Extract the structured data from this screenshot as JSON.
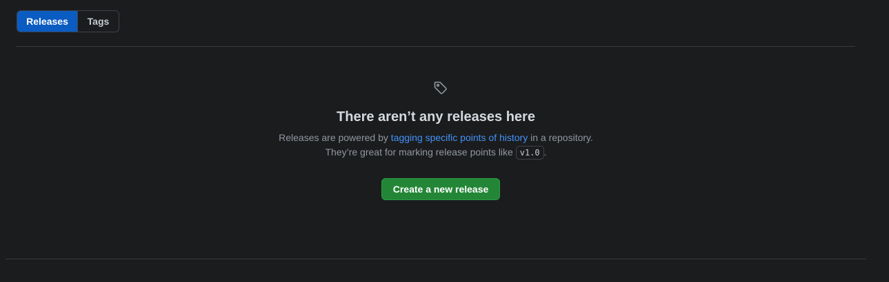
{
  "tabs": [
    {
      "label": "Releases",
      "selected": true
    },
    {
      "label": "Tags",
      "selected": false
    }
  ],
  "blankslate": {
    "icon": "tag-icon",
    "title": "There aren’t any releases here",
    "line1_prefix": "Releases are powered by ",
    "line1_link": "tagging specific points of history",
    "line1_suffix": " in a repository.",
    "line2_prefix": "They’re great for marking release points like ",
    "line2_code": "v1.0",
    "line2_suffix": ".",
    "button_label": "Create a new release"
  },
  "colors": {
    "background": "#1b1c1e",
    "selected_tab": "#0b5cc2",
    "link": "#4493f8",
    "primary_button": "#238636"
  }
}
